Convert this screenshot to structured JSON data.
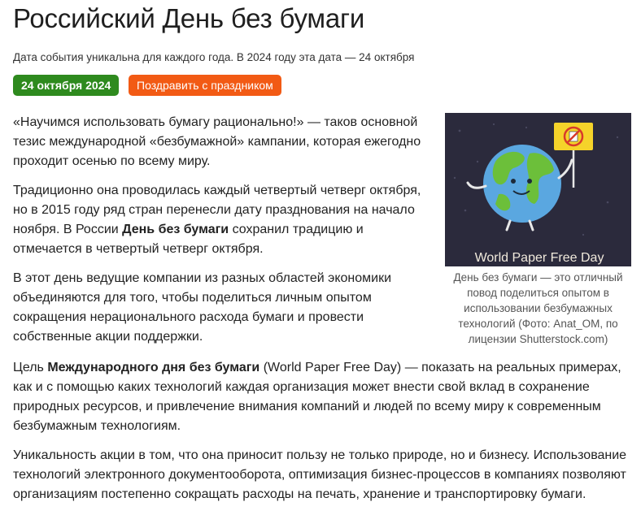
{
  "header": {
    "title": "Российский День без бумаги",
    "subtitle": "Дата события уникальна для каждого года. В 2024 году эта дата — 24 октября",
    "date_badge": "24 октября 2024",
    "congrats_button": "Поздравить с праздником"
  },
  "article": {
    "p1": "«Научимся использовать бумагу рационально!» — таков основной тезис международной «безбумажной» кампании, которая ежегодно проходит осенью по всему миру.",
    "p2_before": "Традиционно она проводилась каждый четвертый четверг октября, но в 2015 году ряд стран перенесли дату празднования на начало ноября. В России ",
    "p2_bold": "День без бумаги",
    "p2_after": " сохранил традицию и отмечается в четвертый четверг октября.",
    "p3": "В этот день ведущие компании из разных областей экономики объединяются для того, чтобы поделиться личным опытом сокращения нерационального расхода бумаги и провести собственные акции поддержки.",
    "p4_before": "Цель ",
    "p4_bold": "Международного дня без бумаги",
    "p4_after": " (World Paper Free Day) — показать на реальных примерах, как и с помощью каких технологий каждая организация может внести свой вклад в сохранение природных ресурсов, и привлечение внимания компаний и людей по всему миру к современным безбумажным технологиям.",
    "p5": "Уникальность акции в том, что она приносит пользу не только природе, но и бизнесу. Использование технологий электронного документооборота, оптимизация бизнес-процессов в компаниях позволяют организациям постепенно сокращать расходы на печать, хранение и транспортировку бумаги."
  },
  "figure": {
    "image_text": "World Paper Free Day",
    "caption": "День без бумаги — это отличный повод поделиться опытом в использовании безбумажных технологий (Фото: Anat_OM, по лицензии Shutterstock.com)"
  },
  "colors": {
    "date_badge": "#2e8a1e",
    "congrats_button": "#f25a14",
    "image_background": "#2b2a3c",
    "globe_ocean": "#5aa7e0",
    "globe_land": "#6cbf3a",
    "sign": "#f5d32a"
  }
}
